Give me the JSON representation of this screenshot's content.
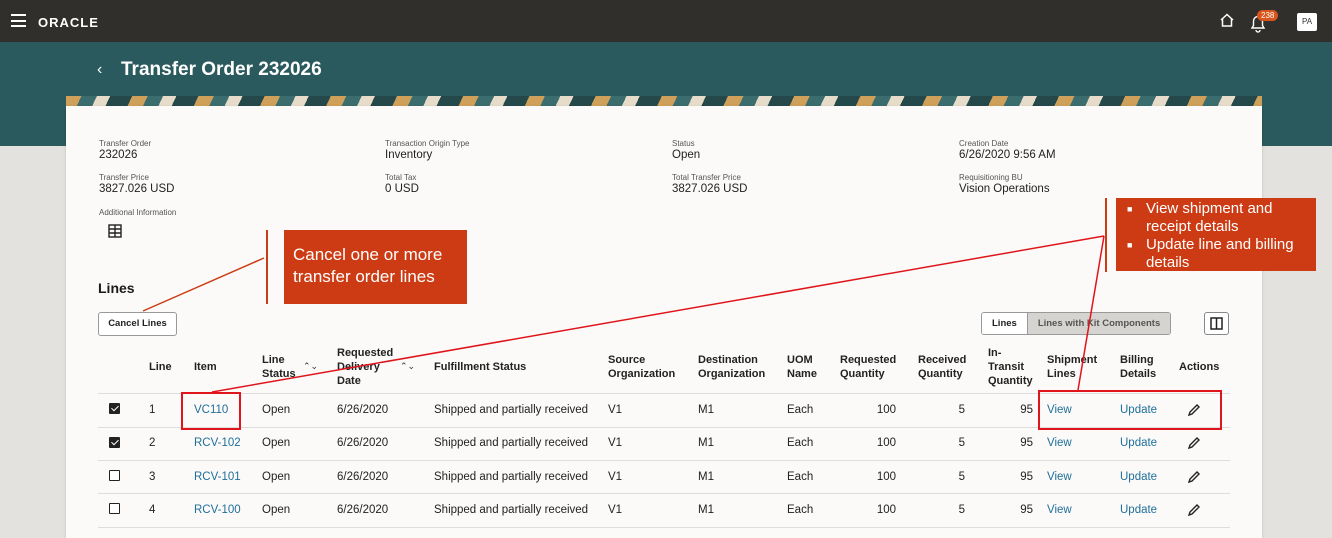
{
  "app": {
    "brand": "ORACLE",
    "notification_count": "238",
    "user_initials": "PA"
  },
  "page": {
    "title": "Transfer Order 232026"
  },
  "header_fields": [
    {
      "label": "Transfer Order",
      "value": "232026"
    },
    {
      "label": "Transaction Origin Type",
      "value": "Inventory"
    },
    {
      "label": "Status",
      "value": "Open"
    },
    {
      "label": "Creation Date",
      "value": "6/26/2020 9:56 AM"
    },
    {
      "label": "Transfer Price",
      "value": "3827.026 USD"
    },
    {
      "label": "Total Tax",
      "value": "0 USD"
    },
    {
      "label": "Total Transfer Price",
      "value": "3827.026 USD"
    },
    {
      "label": "Requisitioning BU",
      "value": "Vision Operations"
    }
  ],
  "additional_info_label": "Additional Information",
  "lines_section": {
    "title": "Lines",
    "cancel_button": "Cancel Lines",
    "toggle": {
      "lines": "Lines",
      "kit": "Lines with Kit Components"
    },
    "columns": {
      "line": "Line",
      "item": "Item",
      "line_status": "Line Status",
      "requested_delivery_date": "Requested Delivery Date",
      "fulfillment_status": "Fulfillment Status",
      "source_org": "Source Organization",
      "dest_org": "Destination Organization",
      "uom": "UOM Name",
      "req_qty": "Requested Quantity",
      "rec_qty": "Received Quantity",
      "transit_qty": "In-Transit Quantity",
      "shipment_lines": "Shipment Lines",
      "billing_details": "Billing Details",
      "actions": "Actions"
    },
    "rows": [
      {
        "checked": true,
        "line": "1",
        "item": "VC110",
        "status": "Open",
        "date": "6/26/2020",
        "fulfillment": "Shipped and partially received",
        "source": "V1",
        "dest": "M1",
        "uom": "Each",
        "req": "100",
        "rec": "5",
        "transit": "95",
        "shipment": "View",
        "billing": "Update"
      },
      {
        "checked": true,
        "line": "2",
        "item": "RCV-102",
        "status": "Open",
        "date": "6/26/2020",
        "fulfillment": "Shipped and partially received",
        "source": "V1",
        "dest": "M1",
        "uom": "Each",
        "req": "100",
        "rec": "5",
        "transit": "95",
        "shipment": "View",
        "billing": "Update"
      },
      {
        "checked": false,
        "line": "3",
        "item": "RCV-101",
        "status": "Open",
        "date": "6/26/2020",
        "fulfillment": "Shipped and partially received",
        "source": "V1",
        "dest": "M1",
        "uom": "Each",
        "req": "100",
        "rec": "5",
        "transit": "95",
        "shipment": "View",
        "billing": "Update"
      },
      {
        "checked": false,
        "line": "4",
        "item": "RCV-100",
        "status": "Open",
        "date": "6/26/2020",
        "fulfillment": "Shipped and partially received",
        "source": "V1",
        "dest": "M1",
        "uom": "Each",
        "req": "100",
        "rec": "5",
        "transit": "95",
        "shipment": "View",
        "billing": "Update"
      }
    ]
  },
  "callouts": {
    "cancel": "Cancel one or more transfer order lines",
    "details": [
      "View shipment and receipt details",
      "Update line and billing details"
    ]
  },
  "colors": {
    "topbar": "#302f2c",
    "banner": "#2a5a5e",
    "link": "#1f6f9a",
    "callout": "#cc3b13",
    "highlight": "#e0141b"
  }
}
